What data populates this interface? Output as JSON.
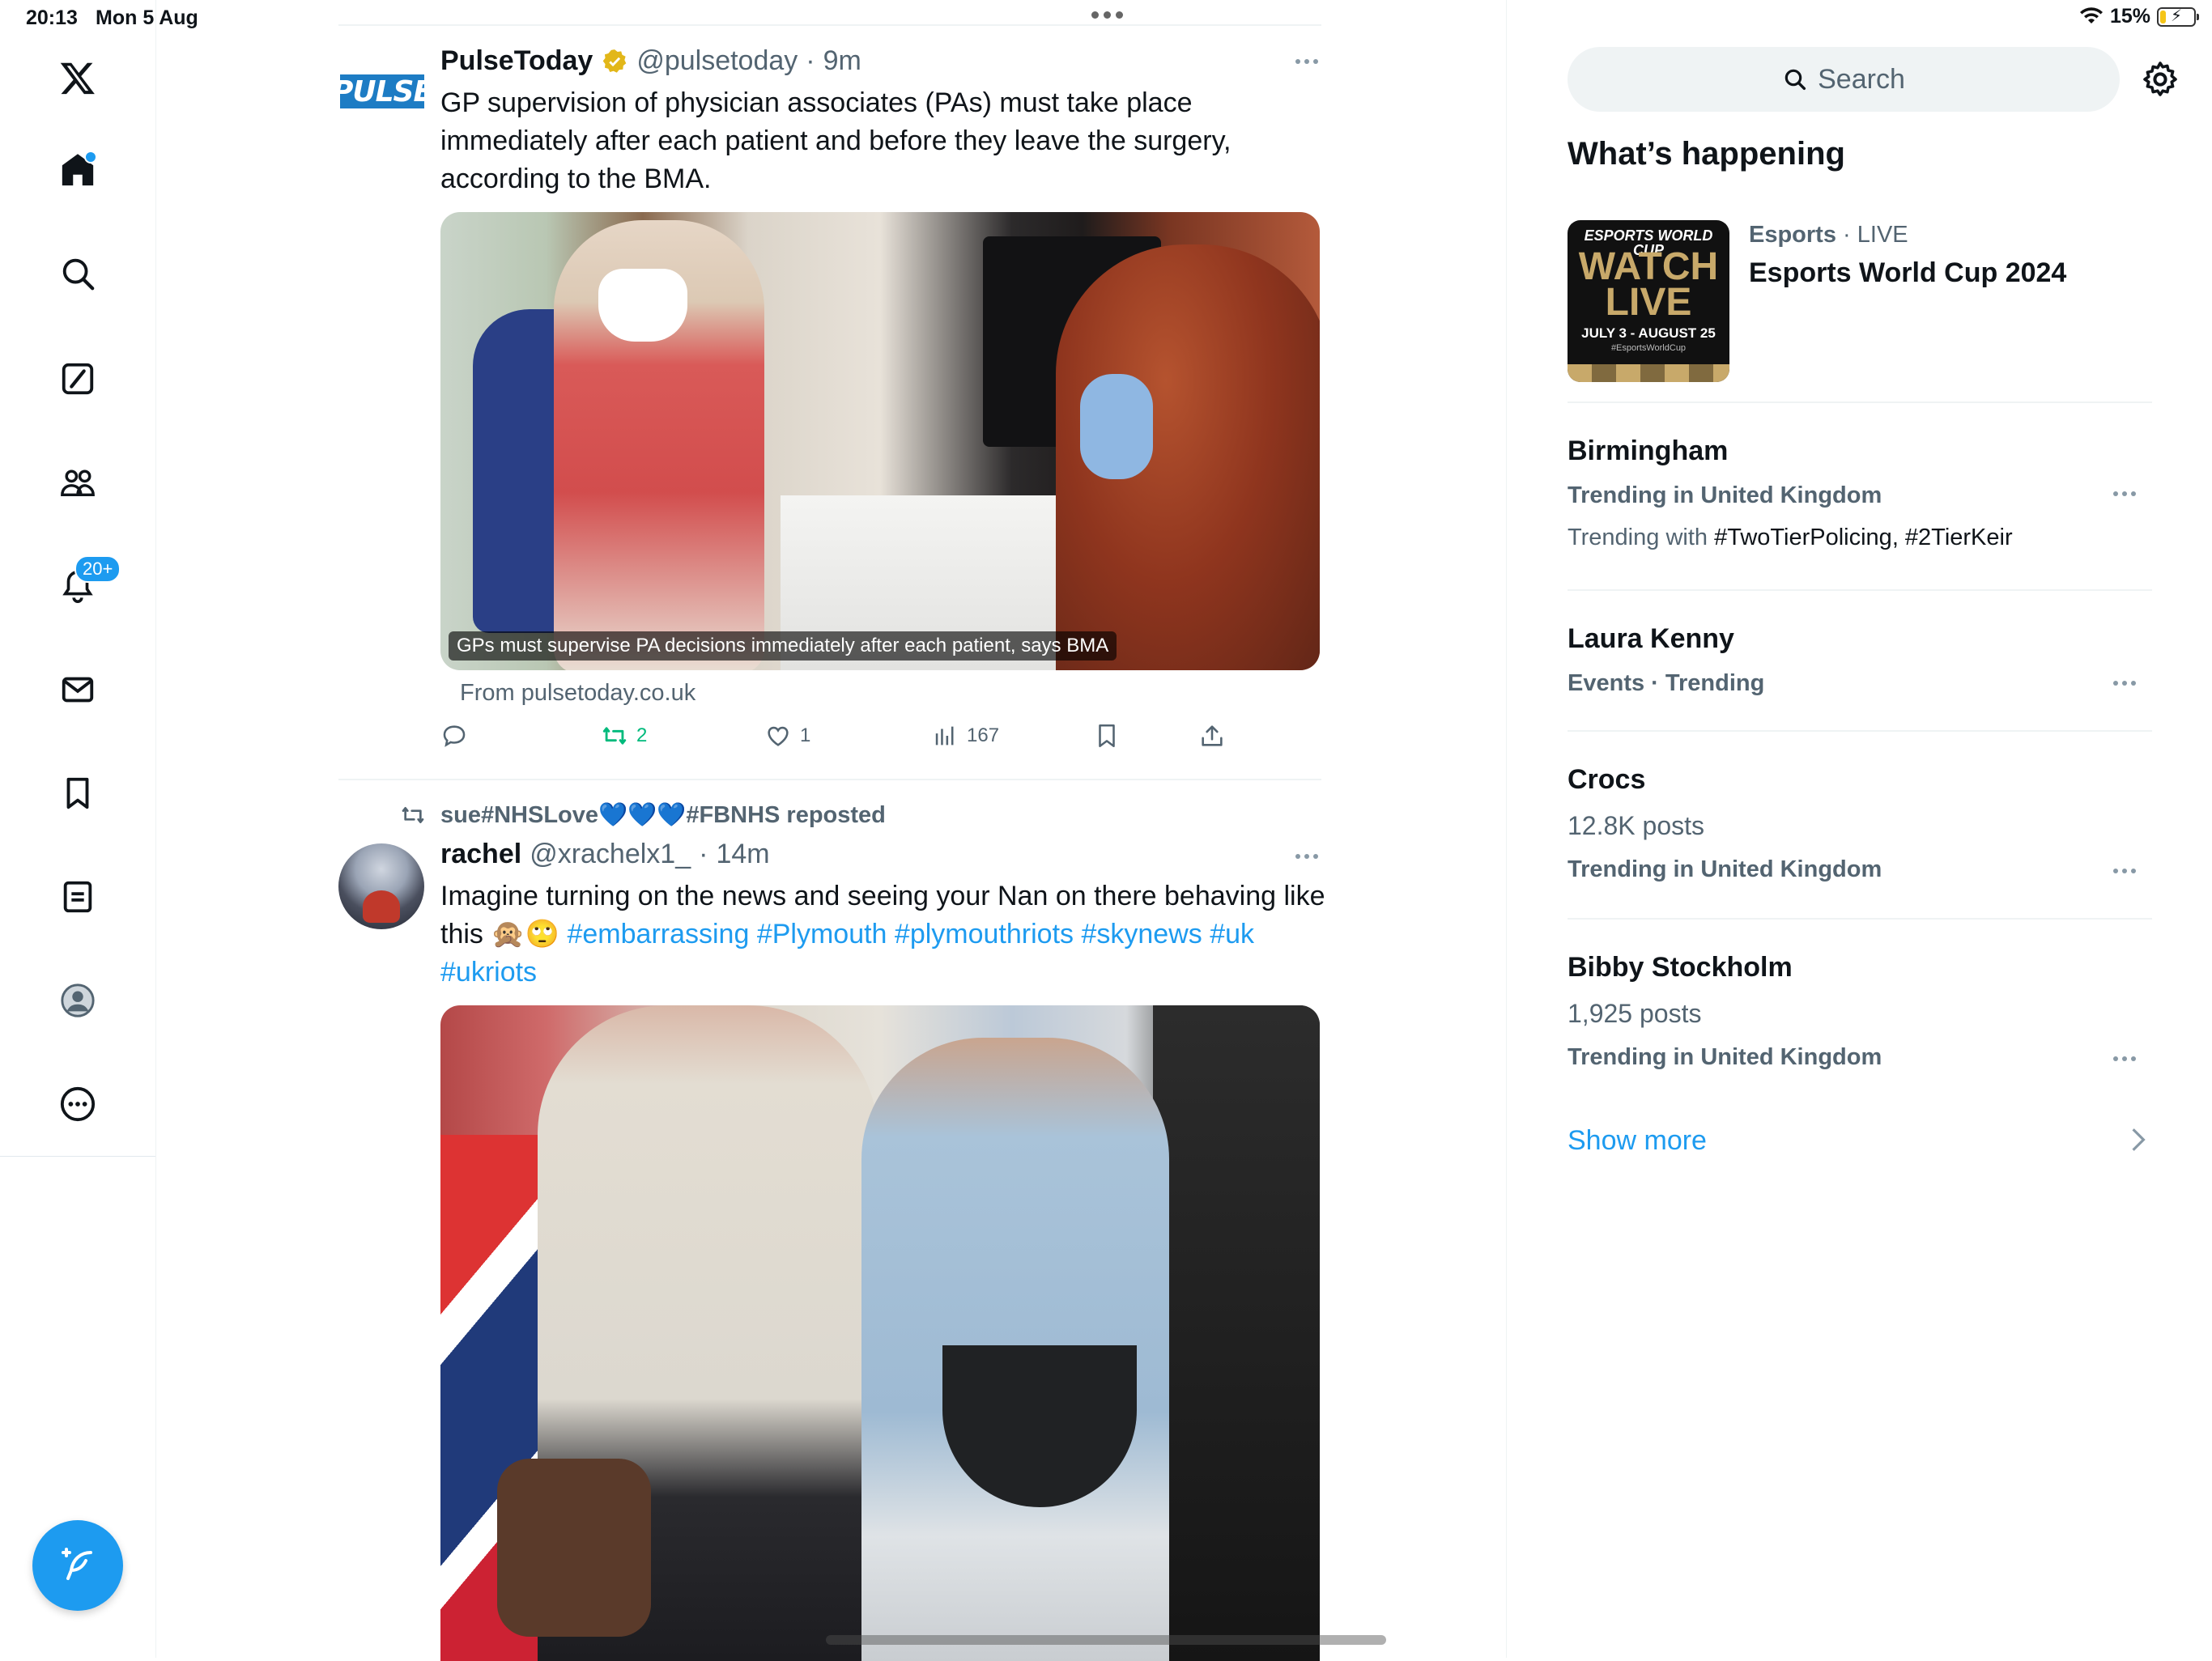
{
  "status_bar": {
    "time": "20:13",
    "date": "Mon 5 Aug",
    "battery_percent": "15%",
    "battery_level": 0.15,
    "wifi_icon": "wifi-icon"
  },
  "nav": {
    "items": [
      {
        "name": "x-logo"
      },
      {
        "name": "home",
        "has_dot": true
      },
      {
        "name": "explore"
      },
      {
        "name": "grok"
      },
      {
        "name": "communities"
      },
      {
        "name": "notifications",
        "badge": "20+"
      },
      {
        "name": "messages"
      },
      {
        "name": "bookmarks"
      },
      {
        "name": "lists"
      },
      {
        "name": "profile"
      },
      {
        "name": "more"
      }
    ],
    "compose_icon": "compose-feather-icon",
    "accent": "#1d9bf0"
  },
  "feed": {
    "tweet1": {
      "avatar_text": "PULSE",
      "name": "PulseToday",
      "handle": "@pulsetoday",
      "sep": "·",
      "time": "9m",
      "text": "GP supervision of physician associates (PAs) must take place immediately after each patient and before they leave the surgery, according to the BMA.",
      "media_caption": "GPs must supervise PA decisions immediately after each patient, says BMA",
      "from": "From pulsetoday.co.uk",
      "retweets": "2",
      "likes": "1",
      "views": "167"
    },
    "tweet2": {
      "repost_by": "sue#NHSLove💙💙💙#FBNHS reposted",
      "name": "rachel",
      "handle": "@xrachelx1_",
      "sep": "·",
      "time": "14m",
      "text_plain": "Imagine turning on the news and seeing your Nan on there behaving like this 🙊🙄 ",
      "hashtags": [
        "#embarrassing",
        "#Plymouth",
        "#plymouthriots",
        "#skynews",
        "#uk",
        "#ukriots"
      ]
    }
  },
  "sidebar": {
    "search_placeholder": "Search",
    "heading": "What’s happening",
    "esports": {
      "category": "Esports",
      "dot": "·",
      "live": "LIVE",
      "title": "Esports World Cup 2024",
      "thumb_top": "ESPORTS WORLD CUP",
      "thumb_watch": "WATCH",
      "thumb_live": "LIVE",
      "thumb_dates": "JULY 3 - AUGUST 25",
      "thumb_tag": "#EsportsWorldCup"
    },
    "trends": [
      {
        "title": "Birmingham",
        "meta": "Trending in United Kingdom",
        "with_prefix": "Trending with ",
        "with_tags": "#TwoTierPolicing, #2TierKeir"
      },
      {
        "title": "Laura Kenny",
        "meta": "Events · Trending"
      },
      {
        "title": "Crocs",
        "posts": "12.8K posts",
        "meta": "Trending in United Kingdom"
      },
      {
        "title": "Bibby Stockholm",
        "posts": "1,925 posts",
        "meta": "Trending in United Kingdom"
      }
    ],
    "show_more": "Show more"
  }
}
